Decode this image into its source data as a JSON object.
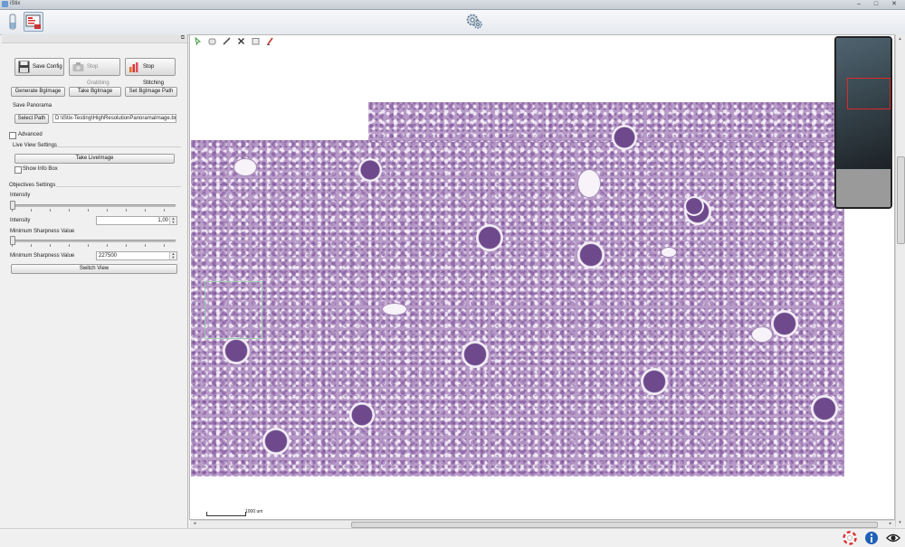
{
  "window": {
    "title": "iStix",
    "min": "–",
    "max": "□",
    "close": "✕"
  },
  "toolbar": {
    "icons": [
      "probe-tube-icon",
      "stitch-panel-icon",
      "settings-gear-icon"
    ]
  },
  "panel": {
    "float_glyph": "⧉",
    "save_config": "Save Config",
    "stop_grabbing": "Stop Grabbing",
    "stop_stitching": "Stop Stitching",
    "generate_bgimage": "Generate BgImage",
    "take_bgimage": "Take BgImage",
    "set_bgimage_path": "Set BgImage Path",
    "save_panorama_label": "Save Panorama",
    "select_path": "Select Path",
    "path_value": "D:\\iStix-Testing\\HighResolutionPanoramaImage.bmp",
    "advanced": "Advanced",
    "live_view_label": "Live View Settings",
    "take_liveimage": "Take LiveImage",
    "show_info_box": "Show Info Box",
    "objectives_label": "Objectives Settings",
    "intensity_label": "Intensity",
    "intensity_field_label": "Intensity",
    "intensity_value": "1,00",
    "min_sharpness_label": "Minimum Sharpness Value",
    "min_sharpness_field_label": "Minimum Sharpness Value",
    "min_sharpness_value": "227500",
    "switch_view": "Switch View"
  },
  "viewer": {
    "tools": [
      "pointer-icon",
      "ellipse-icon",
      "pen-icon",
      "delete-icon",
      "rectangle-icon",
      "brush-icon"
    ],
    "scale_label": "1000 um"
  },
  "colors": {
    "tissue": "#b89bc8",
    "overview_frame": "#e02828",
    "roi": "#9fcfb0"
  },
  "status": {
    "icons": [
      "lifebuoy-icon",
      "info-icon",
      "eye-icon"
    ]
  }
}
